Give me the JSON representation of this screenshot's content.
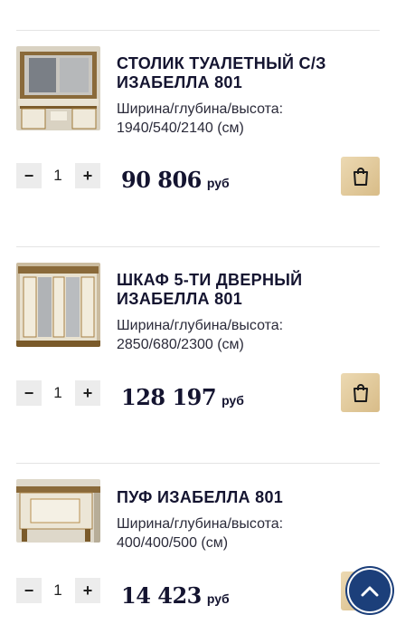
{
  "products": [
    {
      "title_line1": "СТОЛИК ТУАЛЕТНЫЙ С/З",
      "title_line2": "ИЗАБЕЛЛА 801",
      "dims_label": "Ширина/глубина/высота:",
      "dims_value": "1940/540/2140 (см)",
      "qty": "1",
      "price": "90 806",
      "currency": "руб"
    },
    {
      "title_line1": "ШКАФ 5-ТИ ДВЕРНЫЙ",
      "title_line2": "ИЗАБЕЛЛА 801",
      "dims_label": "Ширина/глубина/высота:",
      "dims_value": "2850/680/2300 (см)",
      "qty": "1",
      "price": "128 197",
      "currency": "руб"
    },
    {
      "title_line1": "ПУФ ИЗАБЕЛЛА 801",
      "title_line2": "",
      "dims_label": "Ширина/глубина/высота:",
      "dims_value": "400/400/500 (см)",
      "qty": "1",
      "price": "14 423",
      "currency": "руб"
    }
  ],
  "controls": {
    "minus": "−",
    "plus": "+"
  },
  "icons": {
    "cart": "shopping-bag-icon",
    "scroll_top": "chevron-up-icon"
  },
  "colors": {
    "accent_gold": "#d8bc88",
    "scroll_button": "#1c3f7a",
    "text": "#141430"
  }
}
